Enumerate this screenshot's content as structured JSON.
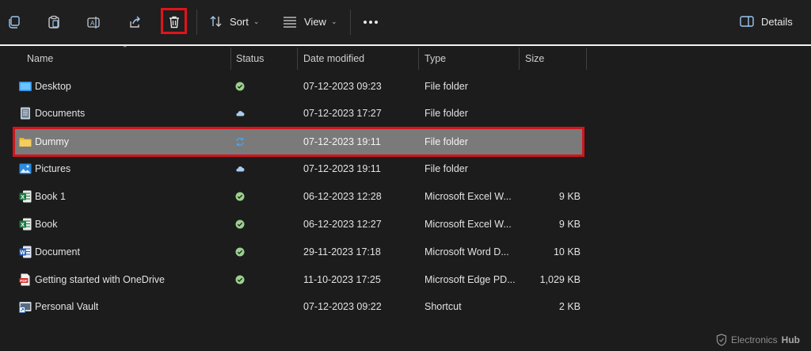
{
  "toolbar": {
    "sort_label": "Sort",
    "view_label": "View",
    "details_label": "Details",
    "highlight_color": "#e0141b"
  },
  "columns": [
    "Name",
    "Status",
    "Date modified",
    "Type",
    "Size"
  ],
  "rows": [
    {
      "name": "Desktop",
      "icon": "desktop-folder-icon",
      "status": "synced",
      "date": "07-12-2023 09:23",
      "type": "File folder",
      "size": ""
    },
    {
      "name": "Documents",
      "icon": "documents-folder-icon",
      "status": "cloud",
      "date": "07-12-2023 17:27",
      "type": "File folder",
      "size": ""
    },
    {
      "name": "Dummy",
      "icon": "folder-icon",
      "status": "syncing",
      "date": "07-12-2023 19:11",
      "type": "File folder",
      "size": "",
      "selected": true
    },
    {
      "name": "Pictures",
      "icon": "pictures-folder-icon",
      "status": "cloud",
      "date": "07-12-2023 19:11",
      "type": "File folder",
      "size": ""
    },
    {
      "name": "Book 1",
      "icon": "excel-file-icon",
      "status": "synced",
      "date": "06-12-2023 12:28",
      "type": "Microsoft Excel W...",
      "size": "9 KB"
    },
    {
      "name": "Book",
      "icon": "excel-file-icon",
      "status": "synced",
      "date": "06-12-2023 12:27",
      "type": "Microsoft Excel W...",
      "size": "9 KB"
    },
    {
      "name": "Document",
      "icon": "word-file-icon",
      "status": "synced",
      "date": "29-11-2023 17:18",
      "type": "Microsoft Word D...",
      "size": "10 KB"
    },
    {
      "name": "Getting started with OneDrive",
      "icon": "pdf-file-icon",
      "status": "synced",
      "date": "11-10-2023 17:25",
      "type": "Microsoft Edge PD...",
      "size": "1,029 KB"
    },
    {
      "name": "Personal Vault",
      "icon": "shortcut-icon",
      "status": "",
      "date": "07-12-2023 09:22",
      "type": "Shortcut",
      "size": "2 KB"
    }
  ],
  "watermark": {
    "prefix": "Electronics",
    "suffix": "Hub"
  }
}
